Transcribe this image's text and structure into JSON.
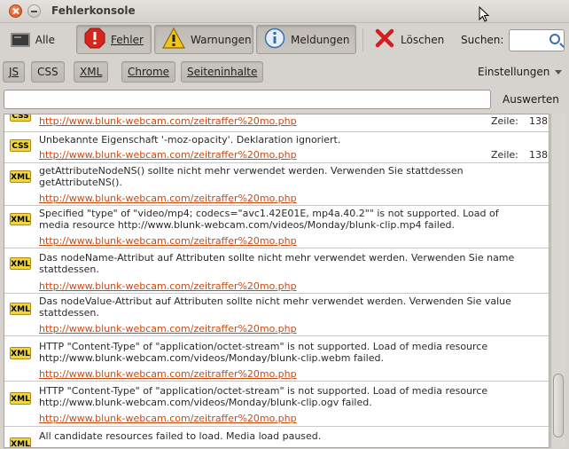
{
  "window": {
    "title": "Fehlerkonsole"
  },
  "toolbar": {
    "all_label": "Alle",
    "errors_label": "Fehler",
    "warnings_label": "Warnungen",
    "messages_label": "Meldungen",
    "clear_label": "Löschen",
    "search_label": "Suchen:",
    "search_value": ""
  },
  "filters": {
    "js_label": "JS",
    "css_label": "CSS",
    "xml_label": "XML",
    "chrome_label": "Chrome",
    "content_label": "Seiteninhalte",
    "settings_label": "Einstellungen"
  },
  "evaluate": {
    "input_value": "",
    "button_label": "Auswerten"
  },
  "messages": [
    {
      "type": "css",
      "icon_label": "CSS",
      "text": "",
      "url": "http://www.blunk-webcam.com/zeitraffer%20mo.php",
      "line_label": "Zeile:",
      "line": "138"
    },
    {
      "type": "css",
      "icon_label": "CSS",
      "text": "Unbekannte Eigenschaft '-moz-opacity'. Deklaration ignoriert.",
      "url": "http://www.blunk-webcam.com/zeitraffer%20mo.php",
      "line_label": "Zeile:",
      "line": "138"
    },
    {
      "type": "xml",
      "icon_label": "XML",
      "text": "getAttributeNodeNS() sollte nicht mehr verwendet werden. Verwenden Sie stattdessen getAttributeNS().",
      "url": "http://www.blunk-webcam.com/zeitraffer%20mo.php"
    },
    {
      "type": "xml",
      "icon_label": "XML",
      "text": "Specified \"type\" of \"video/mp4; codecs=\"avc1.42E01E, mp4a.40.2\"\" is not supported. Load of media resource http://www.blunk-webcam.com/videos/Monday/blunk-clip.mp4 failed.",
      "url": "http://www.blunk-webcam.com/zeitraffer%20mo.php"
    },
    {
      "type": "xml",
      "icon_label": "XML",
      "text": "Das nodeName-Attribut auf Attributen sollte nicht mehr verwendet werden. Verwenden Sie name stattdessen.",
      "url": "http://www.blunk-webcam.com/zeitraffer%20mo.php"
    },
    {
      "type": "xml",
      "icon_label": "XML",
      "text": "Das nodeValue-Attribut auf Attributen sollte nicht mehr verwendet werden. Verwenden Sie value stattdessen.",
      "url": "http://www.blunk-webcam.com/zeitraffer%20mo.php"
    },
    {
      "type": "xml",
      "icon_label": "XML",
      "text": "HTTP \"Content-Type\" of \"application/octet-stream\" is not supported. Load of media resource http://www.blunk-webcam.com/videos/Monday/blunk-clip.webm failed.",
      "url": "http://www.blunk-webcam.com/zeitraffer%20mo.php"
    },
    {
      "type": "xml",
      "icon_label": "XML",
      "text": "HTTP \"Content-Type\" of \"application/octet-stream\" is not supported. Load of media resource http://www.blunk-webcam.com/videos/Monday/blunk-clip.ogv failed.",
      "url": "http://www.blunk-webcam.com/zeitraffer%20mo.php"
    },
    {
      "type": "xml",
      "icon_label": "XML",
      "text": "All candidate resources failed to load. Media load paused.",
      "url": ""
    }
  ],
  "colors": {
    "link": "#cc4a12",
    "error_icon": "#d9261c",
    "warning_icon": "#f0c419",
    "info_icon": "#3a6fb6",
    "clear_icon": "#d11f1f"
  }
}
